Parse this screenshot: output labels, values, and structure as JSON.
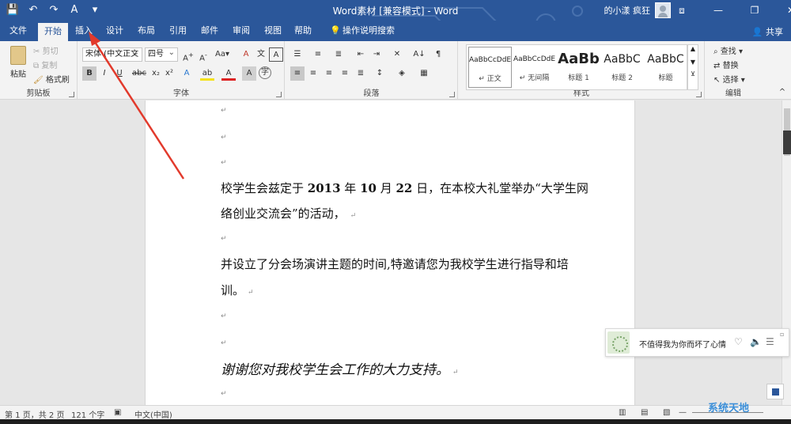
{
  "window": {
    "title": "Word素材 [兼容模式] - Word",
    "user": "的小漾 疯狂",
    "controls": {
      "ribbon": "⧈",
      "minimize": "—",
      "restore": "❐",
      "close": "✕"
    }
  },
  "qat": {
    "save": "💾",
    "undo": "↶",
    "redo": "↷",
    "format": "A",
    "more": "▾"
  },
  "tabs": [
    {
      "label": "文件"
    },
    {
      "label": "开始"
    },
    {
      "label": "插入"
    },
    {
      "label": "设计"
    },
    {
      "label": "布局"
    },
    {
      "label": "引用"
    },
    {
      "label": "邮件"
    },
    {
      "label": "审阅"
    },
    {
      "label": "视图"
    },
    {
      "label": "帮助"
    },
    {
      "label": "操作说明搜索"
    }
  ],
  "share_label": "共享",
  "ribbon": {
    "clipboard": {
      "label": "剪贴板",
      "paste": "粘贴",
      "cut": "剪切",
      "copy": "复制",
      "format_painter": "格式刷"
    },
    "font": {
      "label": "字体",
      "font_name": "宋体 (中文正文",
      "font_size": "四号"
    },
    "paragraph": {
      "label": "段落"
    },
    "styles": {
      "label": "样式",
      "items": [
        {
          "sample": "AaBbCcDdE",
          "name": "↵ 正文"
        },
        {
          "sample": "AaBbCcDdE",
          "name": "↵ 无间隔"
        },
        {
          "sample": "AaBb",
          "name": "标题 1"
        },
        {
          "sample": "AaBbC",
          "name": "标题 2"
        },
        {
          "sample": "AaBbC",
          "name": "标题"
        }
      ]
    },
    "editing": {
      "label": "编辑",
      "find": "查找",
      "replace": "替换",
      "select": "选择"
    }
  },
  "document": {
    "para_mark": "↵",
    "p1_a": "校学生会兹定于 ",
    "p1_year": "2013",
    "p1_b": " 年 ",
    "p1_month": "10",
    "p1_c": " 月 ",
    "p1_day": "22",
    "p1_d": " 日，在本校大礼堂举办“大学生网",
    "p1_line2": "络创业交流会”的活动，",
    "p2_line1": "并设立了分会场演讲主题的时间,特邀请您为我校学生进行指导和培",
    "p2_line2": "训。",
    "p3": "谢谢您对我校学生会工作的大力支持。"
  },
  "music_widget": {
    "song": "不值得我为你而坏了心情"
  },
  "status": {
    "page": "第 1 页，共 2 页",
    "words": "121 个字",
    "language": "中文(中国)"
  },
  "watermark": "系统天地",
  "colors": {
    "accent": "#2b579a",
    "annotation": "#e23a2c"
  }
}
